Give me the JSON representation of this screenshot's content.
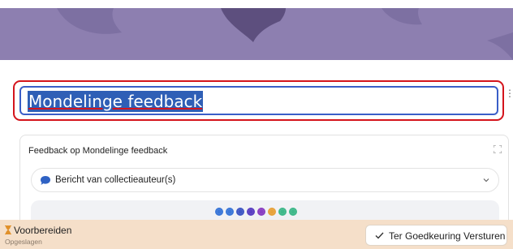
{
  "banner": {
    "background_color": "#8d7fb0",
    "bubble_color": "#5d4f7e"
  },
  "title": {
    "value": "Mondelinge feedback",
    "selection_color": "#2f5fb6",
    "focus_outline_color": "#d4141c"
  },
  "card": {
    "title": "Feedback op Mondelinge feedback",
    "dropdown": {
      "label": "Bericht van collectieauteur(s)",
      "icon": "chat-bubble-icon"
    },
    "dots": [
      {
        "color": "#3a76d8"
      },
      {
        "color": "#3a76d8"
      },
      {
        "color": "#3f57c4"
      },
      {
        "color": "#5a3fc2"
      },
      {
        "color": "#8a3fc2"
      },
      {
        "color": "#e8a23a"
      },
      {
        "color": "#3fb88a"
      },
      {
        "color": "#3fb88a"
      }
    ]
  },
  "status": {
    "label": "Voorbereiden",
    "sublabel": "Opgeslagen",
    "icon": "hourglass-icon",
    "background_color": "#f5dfc9"
  },
  "submit_button": {
    "label": "Ter Goedkeuring Versturen",
    "icon": "check-icon"
  }
}
